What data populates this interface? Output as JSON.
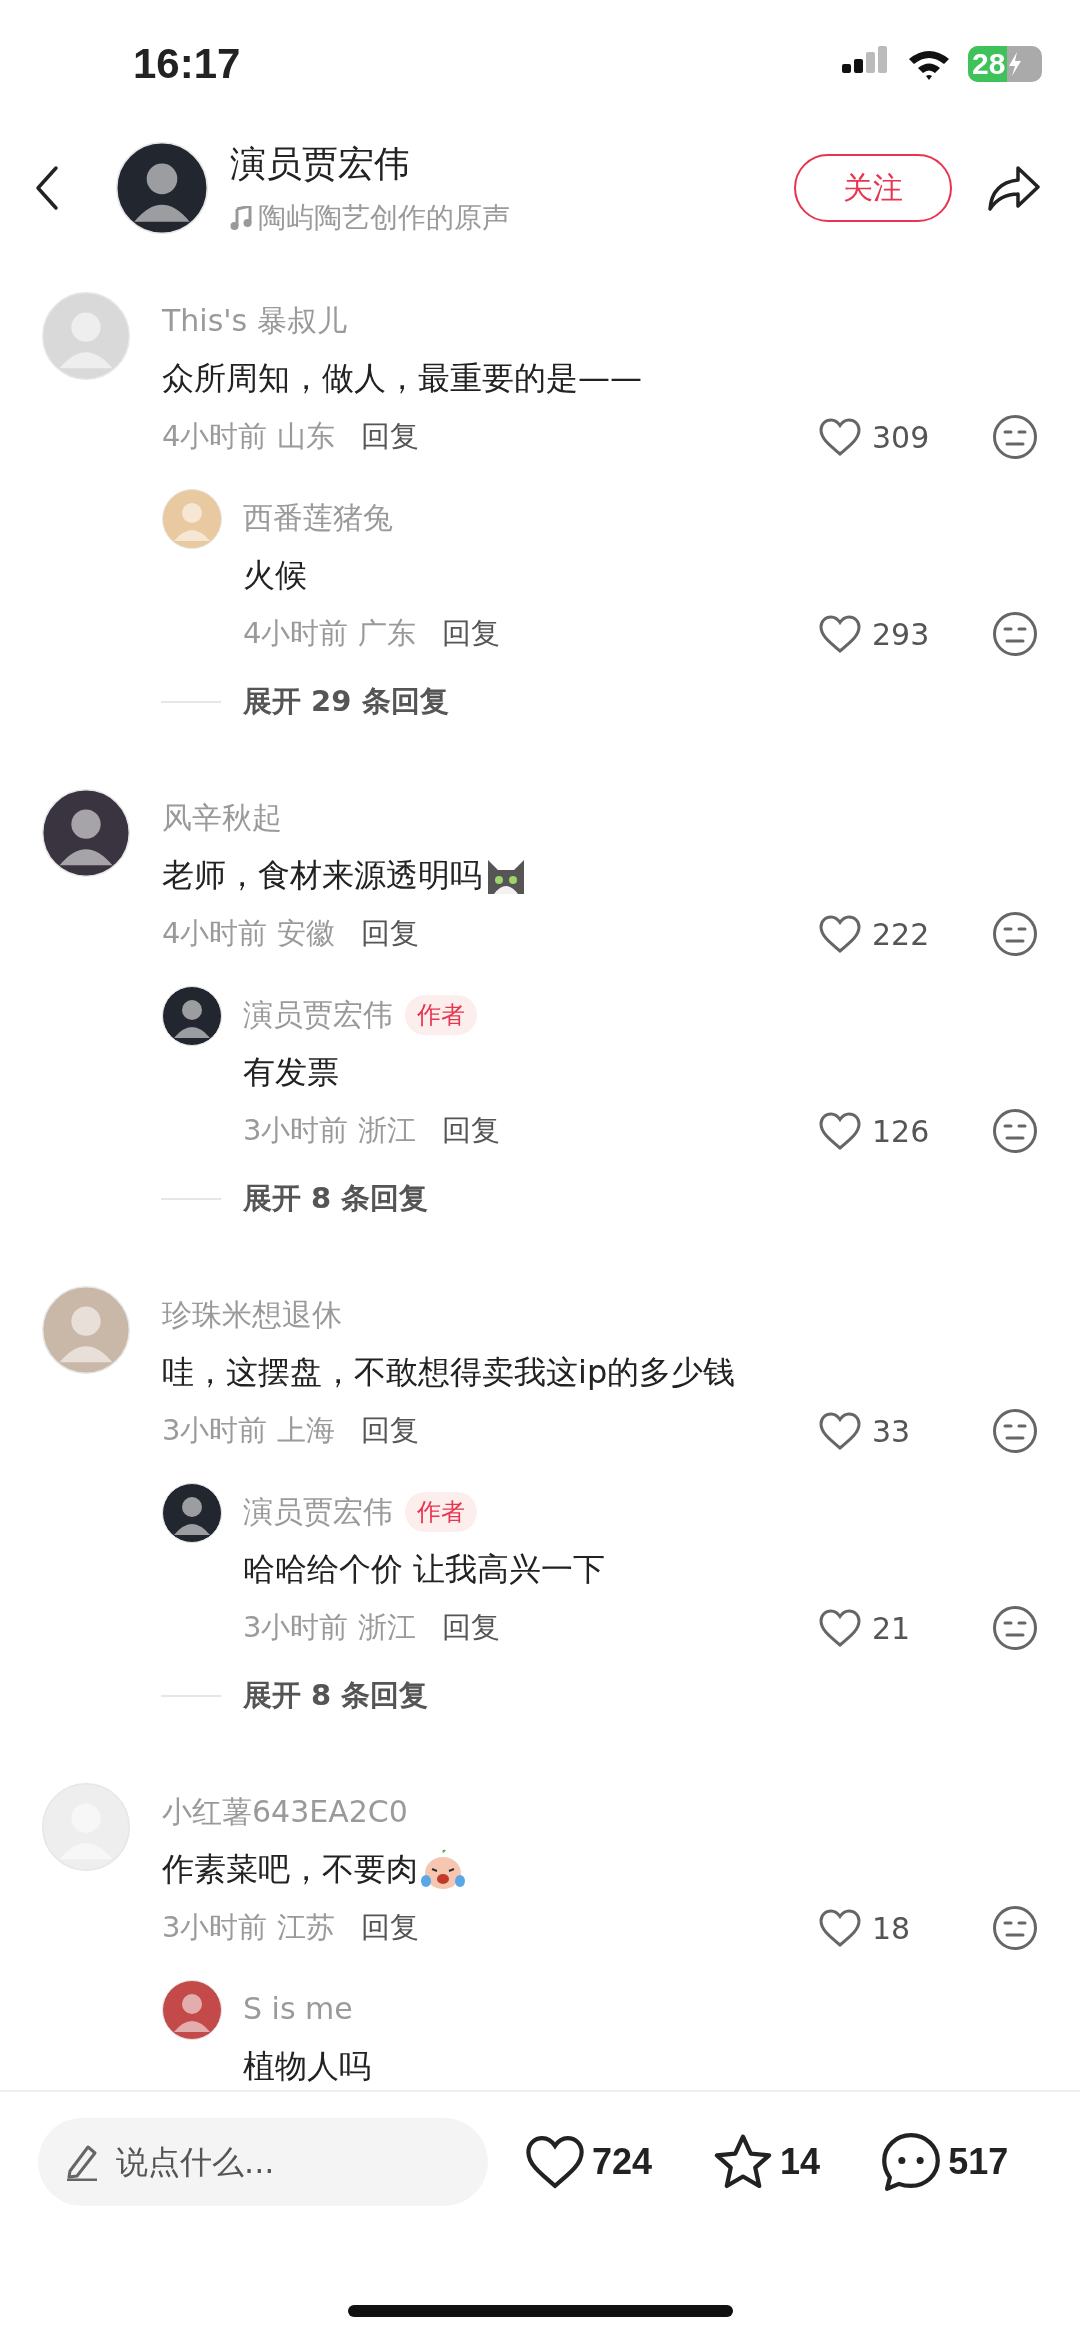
{
  "status_bar": {
    "time": "16:17",
    "battery": "28"
  },
  "header": {
    "author": "演员贾宏伟",
    "sound": "陶屿陶艺创作的原声",
    "follow_button": "关注"
  },
  "comments": [
    {
      "name": "This's 暴叔儿",
      "text": "众所周知，做人，最重要的是——",
      "time": "4小时前",
      "location": "山东",
      "reply_label": "回复",
      "likes": "309",
      "replies": [
        {
          "name": "西番莲猪兔",
          "text": "火候",
          "time": "4小时前",
          "location": "广东",
          "reply_label": "回复",
          "likes": "293"
        }
      ],
      "more_replies": "展开 29 条回复"
    },
    {
      "name": "风辛秋起",
      "text": "老师，食材来源透明吗",
      "kind": "cat",
      "time": "4小时前",
      "location": "安徽",
      "reply_label": "回复",
      "likes": "222",
      "replies": [
        {
          "name": "演员贾宏伟",
          "badge": "作者",
          "text": "有发票",
          "time": "3小时前",
          "location": "浙江",
          "reply_label": "回复",
          "likes": "126"
        }
      ],
      "more_replies": "展开 8 条回复"
    },
    {
      "name": "珍珠米想退休",
      "text": "哇，这摆盘，不敢想得卖我这ip的多少钱",
      "time": "3小时前",
      "location": "上海",
      "reply_label": "回复",
      "likes": "33",
      "replies": [
        {
          "name": "演员贾宏伟",
          "badge": "作者",
          "text": "哈哈给个价 让我高兴一下",
          "time": "3小时前",
          "location": "浙江",
          "reply_label": "回复",
          "likes": "21"
        }
      ],
      "more_replies": "展开 8 条回复"
    },
    {
      "name": "小红薯643EA2C0",
      "text": "作素菜吧，不要肉",
      "kind": "crying",
      "time": "3小时前",
      "location": "江苏",
      "reply_label": "回复",
      "likes": "18",
      "replies": [
        {
          "name": "S is me",
          "text": "植物人吗"
        }
      ]
    }
  ],
  "bottom_bar": {
    "placeholder": "说点什么...",
    "likes": "724",
    "favorites": "14",
    "comments": "517"
  }
}
